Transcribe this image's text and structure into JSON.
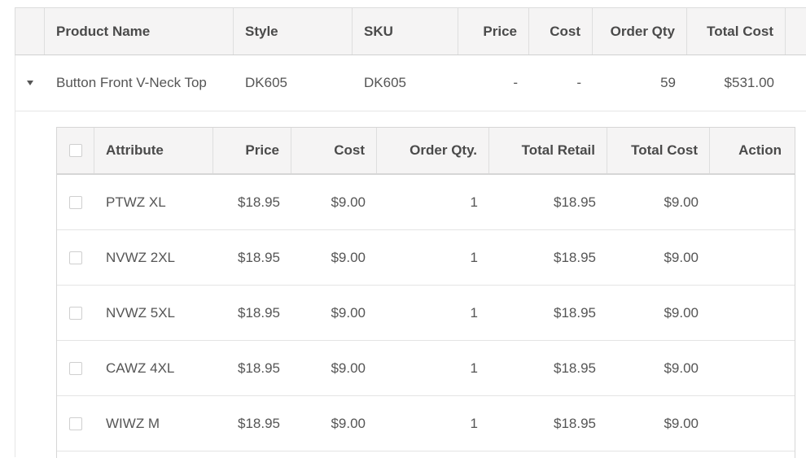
{
  "outer": {
    "columns": [
      "",
      "Product Name",
      "Style",
      "SKU",
      "Price",
      "Cost",
      "Order Qty",
      "Total Cost"
    ],
    "row": {
      "product_name": "Button Front V-Neck Top",
      "style": "DK605",
      "sku": "DK605",
      "price": "-",
      "cost": "-",
      "order_qty": "59",
      "total_cost": "$531.00"
    }
  },
  "inner": {
    "columns": [
      "",
      "Attribute",
      "Price",
      "Cost",
      "Order Qty.",
      "Total Retail",
      "Total Cost",
      "Action"
    ],
    "rows": [
      {
        "attribute": "PTWZ XL",
        "price": "$18.95",
        "cost": "$9.00",
        "qty": "1",
        "total_retail": "$18.95",
        "total_cost": "$9.00"
      },
      {
        "attribute": "NVWZ 2XL",
        "price": "$18.95",
        "cost": "$9.00",
        "qty": "1",
        "total_retail": "$18.95",
        "total_cost": "$9.00"
      },
      {
        "attribute": "NVWZ 5XL",
        "price": "$18.95",
        "cost": "$9.00",
        "qty": "1",
        "total_retail": "$18.95",
        "total_cost": "$9.00"
      },
      {
        "attribute": "CAWZ 4XL",
        "price": "$18.95",
        "cost": "$9.00",
        "qty": "1",
        "total_retail": "$18.95",
        "total_cost": "$9.00"
      },
      {
        "attribute": "WIWZ M",
        "price": "$18.95",
        "cost": "$9.00",
        "qty": "1",
        "total_retail": "$18.95",
        "total_cost": "$9.00"
      }
    ]
  },
  "icons": {
    "expand": "caret-down-icon",
    "select": "checkbox-icon"
  }
}
